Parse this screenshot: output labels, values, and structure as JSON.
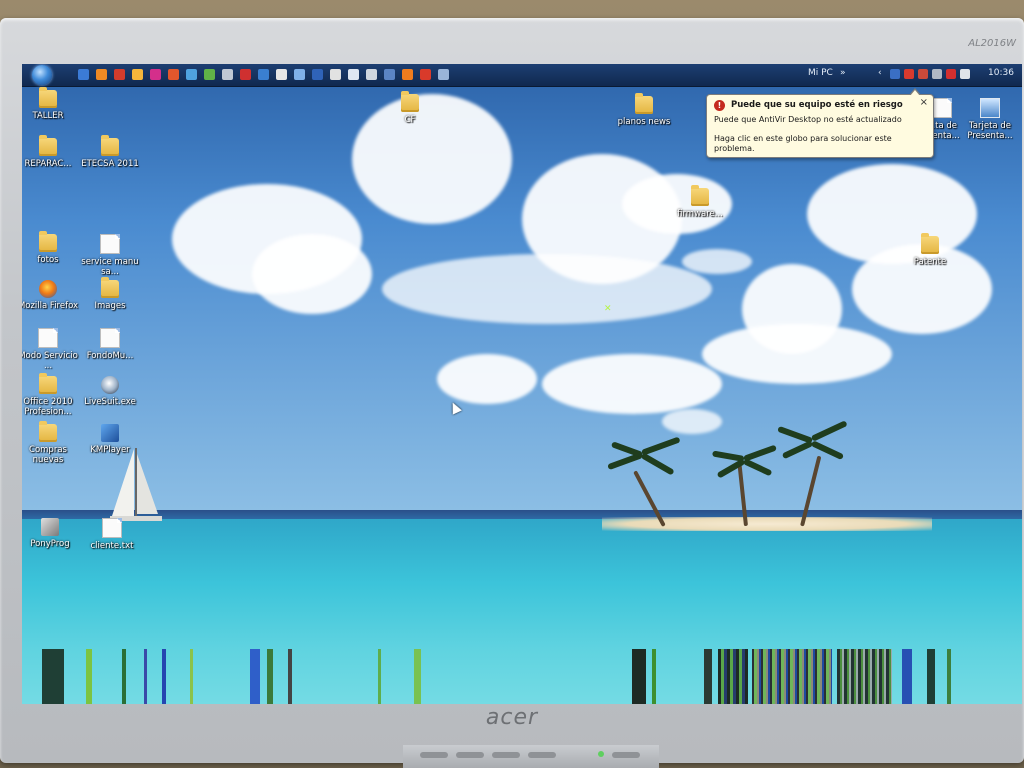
{
  "monitor": {
    "model": "AL2016W",
    "brand": "acer"
  },
  "taskbar": {
    "mi_pc_label": "Mi PC",
    "clock": "10:36"
  },
  "notification": {
    "title": "Puede que su equipo esté en riesgo",
    "line1": "Puede que AntiVir Desktop no esté actualizado",
    "line2": "Haga clic en este globo para solucionar este problema.",
    "close_label": "×"
  },
  "desktop_icons": [
    {
      "label": "TALLER"
    },
    {
      "label": "REPARAC..."
    },
    {
      "label": "ETECSA 2011"
    },
    {
      "label": "fotos"
    },
    {
      "label": "service manu sa..."
    },
    {
      "label": "Mozilla Firefox"
    },
    {
      "label": "Images"
    },
    {
      "label": "Modo Servicio ..."
    },
    {
      "label": "FondoMu..."
    },
    {
      "label": "Office 2010 Profesion..."
    },
    {
      "label": "LiveSuit.exe"
    },
    {
      "label": "Compras nuevas"
    },
    {
      "label": "KMPlayer"
    },
    {
      "label": "PonyProg"
    },
    {
      "label": "cliente.txt"
    },
    {
      "label": "CF"
    },
    {
      "label": "planos news"
    },
    {
      "label": "firmware..."
    },
    {
      "label": "Patente"
    },
    {
      "label": "...ta de ...enta..."
    },
    {
      "label": "Tarjeta de Presenta..."
    }
  ],
  "colors": {
    "taskbar": "#10294f",
    "balloon_bg": "#fffbe0",
    "warning_red": "#c42a1f",
    "sky_top": "#2c63a9",
    "sea": "#3cc4da"
  }
}
